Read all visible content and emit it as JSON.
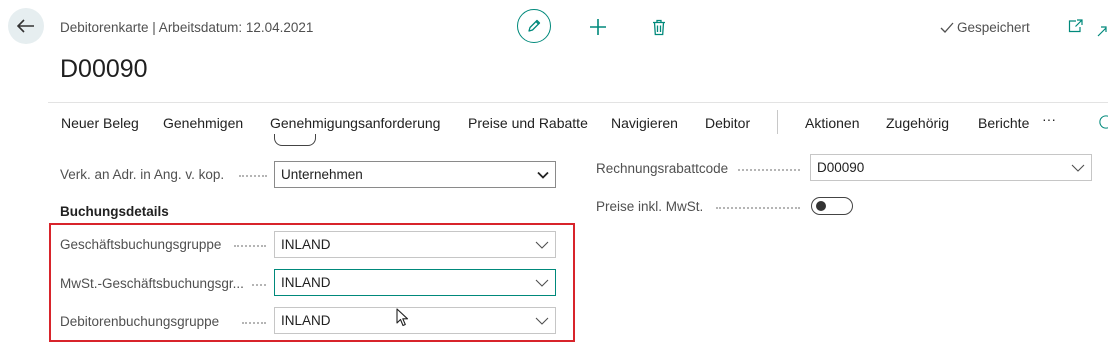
{
  "header": {
    "breadcrumb": "Debitorenkarte | Arbeitsdatum: 12.04.2021",
    "title": "D00090",
    "saved_label": "Gespeichert"
  },
  "actions": [
    "Neuer Beleg",
    "Genehmigen",
    "Genehmigungsanforderung",
    "Preise und Rabatte",
    "Navigieren",
    "Debitor",
    "Aktionen",
    "Zugehörig",
    "Berichte"
  ],
  "more_actions": "···",
  "form": {
    "verk_label": "Verk. an Adr. in Ang. v. kop.",
    "verk_value": "Unternehmen",
    "section_title": "Buchungsdetails",
    "geschaeft_label": "Geschäftsbuchungsgruppe",
    "geschaeft_value": "INLAND",
    "mwst_label": "MwSt.-Geschäftsbuchungsgr...",
    "mwst_value": "INLAND",
    "debitor_label": "Debitorenbuchungsgruppe",
    "debitor_value": "INLAND",
    "rabatt_label": "Rechnungsrabattcode",
    "rabatt_value": "D00090",
    "preise_label": "Preise inkl. MwSt."
  },
  "colors": {
    "accent": "#00897b",
    "highlight": "#d8242b"
  }
}
